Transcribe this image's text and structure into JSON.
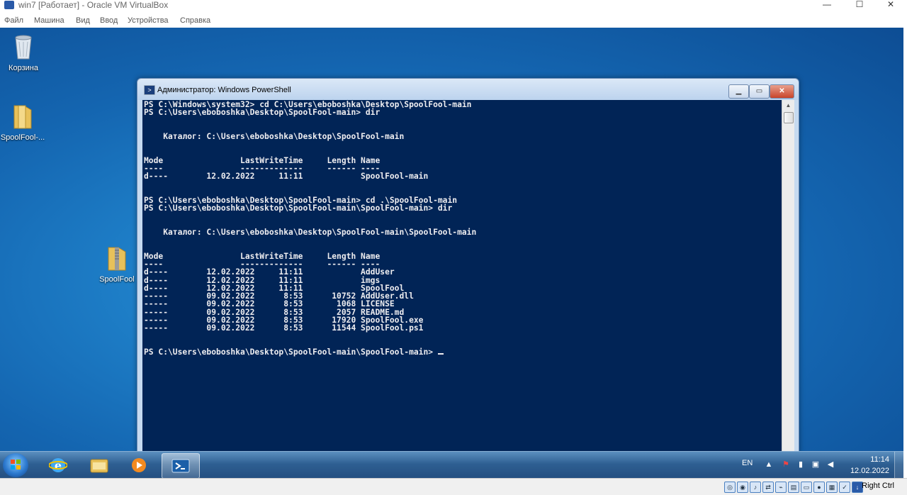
{
  "host": {
    "title": "win7 [Работает] - Oracle VM VirtualBox",
    "controls": {
      "minimize": "—",
      "maximize": "☐",
      "close": "✕"
    },
    "menu": [
      "Файл",
      "Машина",
      "Вид",
      "Ввод",
      "Устройства",
      "Справка"
    ]
  },
  "desktop": {
    "icons": [
      {
        "label": "Корзина",
        "icon": "recycle-bin-icon"
      },
      {
        "label": "SpoolFool-...",
        "icon": "folder-icon"
      },
      {
        "label": "SpoolFool",
        "icon": "zip-folder-icon"
      }
    ]
  },
  "powershell": {
    "title": "Администратор: Windows PowerShell",
    "console": "PS C:\\Windows\\system32> cd C:\\Users\\eboboshka\\Desktop\\SpoolFool-main\nPS C:\\Users\\eboboshka\\Desktop\\SpoolFool-main> dir\n\n\n    Каталог: C:\\Users\\eboboshka\\Desktop\\SpoolFool-main\n\n\nMode                LastWriteTime     Length Name\n----                -------------     ------ ----\nd----        12.02.2022     11:11            SpoolFool-main\n\n\nPS C:\\Users\\eboboshka\\Desktop\\SpoolFool-main> cd .\\SpoolFool-main\nPS C:\\Users\\eboboshka\\Desktop\\SpoolFool-main\\SpoolFool-main> dir\n\n\n    Каталог: C:\\Users\\eboboshka\\Desktop\\SpoolFool-main\\SpoolFool-main\n\n\nMode                LastWriteTime     Length Name\n----                -------------     ------ ----\nd----        12.02.2022     11:11            AddUser\nd----        12.02.2022     11:11            imgs\nd----        12.02.2022     11:11            SpoolFool\n-----        09.02.2022      8:53      10752 AddUser.dll\n-----        09.02.2022      8:53       1068 LICENSE\n-----        09.02.2022      8:53       2057 README.md\n-----        09.02.2022      8:53      17920 SpoolFool.exe\n-----        09.02.2022      8:53      11544 SpoolFool.ps1\n\n\nPS C:\\Users\\eboboshka\\Desktop\\SpoolFool-main\\SpoolFool-main> ",
    "colors": {
      "background": "#012456",
      "foreground": "#eeedf0"
    }
  },
  "taskbar": {
    "pinned": [
      "start-orb-icon",
      "internet-explorer-icon",
      "explorer-icon",
      "media-player-icon",
      "powershell-icon"
    ],
    "tray": {
      "lang": "EN",
      "time": "11:14",
      "date": "12.02.2022"
    }
  },
  "vbox_status": {
    "host_key": "Right Ctrl"
  }
}
